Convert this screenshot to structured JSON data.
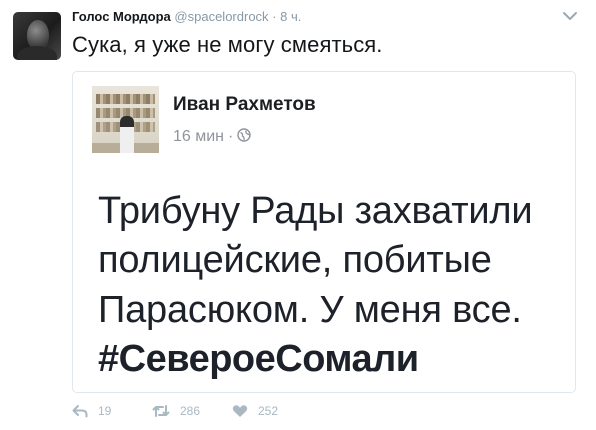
{
  "tweet": {
    "display_name": "Голос Мордора",
    "handle": "@spacelordrock",
    "dot": "·",
    "time": "8 ч.",
    "text": "Сука, я уже не могу смеяться."
  },
  "embedded_post": {
    "author": "Иван Рахметов",
    "time": "16 мин",
    "separator": "·",
    "lines": [
      "Трибуну Рады захватили",
      "полицейские, побитые",
      "Парасюком. У меня все."
    ],
    "hashtag": "#СевероеСомали"
  },
  "actions": {
    "replies": "19",
    "retweets": "286",
    "likes": "252"
  },
  "icons": {
    "reply": "reply-icon",
    "retweet": "retweet-icon",
    "like": "heart-icon",
    "menu": "chevron-down-icon",
    "audience": "globe-icon"
  },
  "colors": {
    "muted": "#8899a6",
    "action": "#aab8c2",
    "border": "#e1e8ed"
  }
}
